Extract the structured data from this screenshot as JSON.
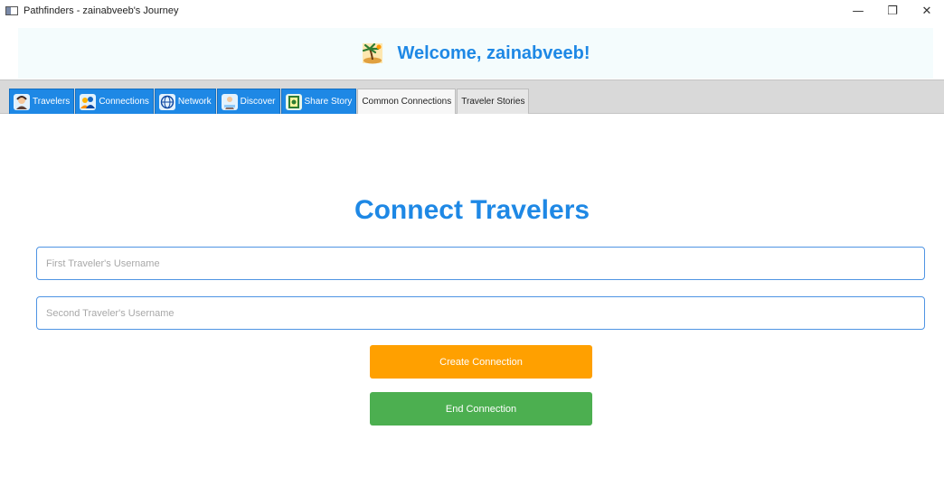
{
  "window": {
    "title": "Pathfinders - zainabveeb's Journey",
    "controls": {
      "minimize": "—",
      "restore": "❐",
      "close": "✕"
    }
  },
  "header": {
    "icon": "palm-island-icon",
    "welcome": "Welcome, zainabveeb!"
  },
  "tabs": [
    {
      "label": "Travelers",
      "icon": "traveler-icon",
      "style": "accent"
    },
    {
      "label": "Connections",
      "icon": "people-icon",
      "style": "accent"
    },
    {
      "label": "Network",
      "icon": "globe-icon",
      "style": "accent"
    },
    {
      "label": "Discover",
      "icon": "explorer-icon",
      "style": "accent"
    },
    {
      "label": "Share Story",
      "icon": "book-icon",
      "style": "accent"
    },
    {
      "label": "Common Connections",
      "style": "selected"
    },
    {
      "label": "Traveler Stories",
      "style": "plain"
    }
  ],
  "main": {
    "title": "Connect Travelers",
    "first_field": {
      "placeholder": "First Traveler's Username",
      "value": ""
    },
    "second_field": {
      "placeholder": "Second Traveler's Username",
      "value": ""
    },
    "create_button": {
      "label": "Create Connection",
      "color": "#ffa000"
    },
    "end_button": {
      "label": "End Connection",
      "color": "#4caf50"
    }
  },
  "colors": {
    "accent": "#1e88e5",
    "header_bg": "#f4fcfd",
    "tabbar_bg": "#d9d9d9"
  }
}
